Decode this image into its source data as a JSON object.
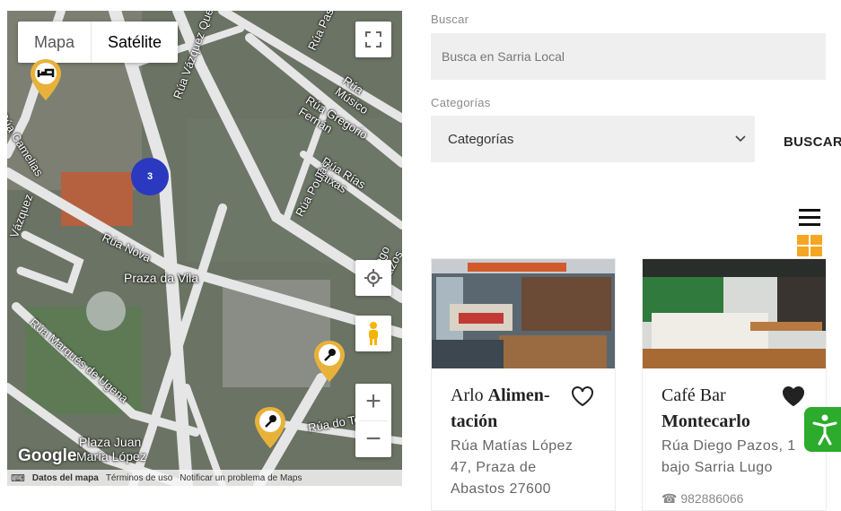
{
  "map": {
    "type_map": "Mapa",
    "type_satellite": "Satélite",
    "cluster_count": "3",
    "google": "Google",
    "footer": {
      "keyboard": "Combinaciones de teclas",
      "data": "Datos del mapa",
      "terms": "Términos de uso",
      "report": "Notificar un problema de Maps"
    },
    "streets": {
      "rua_camelias": "Rúa Camelias",
      "rua_vazquez": "Rúa Vázquez Queipo",
      "rua_pas": "Rúa Pas",
      "rua_musico": "Rúa Músico",
      "rua_gregorio": "Rúa Gregorio Fernán",
      "rua_rias": "Rúa Rías Baixas",
      "rua_poulas": "Rúa Poulas",
      "rua_nova": "Rúa Nova",
      "praza_vila": "Praza da Vila",
      "rua_marques": "Rúa Marqués de Ugena",
      "rua_diego": "Diego Pazos",
      "rua_do_to": "Rúa do To",
      "plaza_juan": "Plaza Juan",
      "maria_lopez": "María López",
      "vazquez": "Vázquez"
    }
  },
  "form": {
    "search_label": "Buscar",
    "search_placeholder": "Busca en Sarria Local",
    "category_label": "Categorías",
    "category_value": "Categorías",
    "submit": "BUSCAR"
  },
  "cards": [
    {
      "title_plain": "Arlo ",
      "title_bold_1": "Alimen-",
      "title_bold_2": "tación",
      "address_1": "Rúa Matías López",
      "address_2": "47, Praza de",
      "address_3": "Abastos 27600",
      "favorite": false
    },
    {
      "title_plain": "Café Bar",
      "title_bold_2": "Montecarlo",
      "address_1": "Rúa Diego Pazos, 1",
      "address_2": "bajo Sarria Lugo",
      "phone": "982886066",
      "favorite": true
    }
  ],
  "colors": {
    "accent": "#f5a623",
    "pin": "#e8b23a",
    "cluster": "#2a39bf",
    "access": "#2cab2c"
  }
}
